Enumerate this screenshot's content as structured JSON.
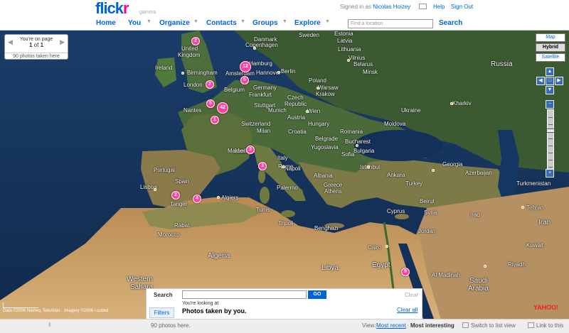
{
  "header": {
    "logo_main": "flick",
    "logo_r": "r",
    "logo_beta": "gamma",
    "signed_in_prefix": "Signed in as",
    "signed_in_user": "Nicolas Hoizey",
    "help": "Help",
    "sign_out": "Sign Out"
  },
  "nav": {
    "home": "Home",
    "you": "You",
    "organize": "Organize",
    "contacts": "Contacts",
    "groups": "Groups",
    "explore": "Explore",
    "location_placeholder": "Find a location",
    "search": "Search"
  },
  "pager": {
    "title": "You're on page",
    "page": "1",
    "of": "of",
    "total": "1",
    "subtitle": "90 photos taken here"
  },
  "map_types": {
    "map": "Map",
    "hybrid": "Hybrid",
    "satellite": "Satellite",
    "selected": "Hybrid"
  },
  "map_labels": [
    {
      "text": "Danmark",
      "big": false
    },
    {
      "text": "Copenhagen",
      "big": false
    },
    {
      "text": "Lithuania",
      "big": false
    },
    {
      "text": "Vilnius",
      "big": false
    },
    {
      "text": "Belarus",
      "big": false
    },
    {
      "text": "Russia",
      "big": true
    },
    {
      "text": "United",
      "big": false
    },
    {
      "text": "Kingdom",
      "big": false
    },
    {
      "text": "Ireland",
      "big": false
    },
    {
      "text": "Birmingham",
      "big": false
    },
    {
      "text": "London",
      "big": false
    },
    {
      "text": "Hamburg",
      "big": false
    },
    {
      "text": "Amsterdam",
      "big": false
    },
    {
      "text": "Hannover",
      "big": false
    },
    {
      "text": "Berlin",
      "big": false
    },
    {
      "text": "Belgium",
      "big": false
    },
    {
      "text": "Germany",
      "big": false
    },
    {
      "text": "Frankfurt",
      "big": false
    },
    {
      "text": "Poland",
      "big": false
    },
    {
      "text": "Warsaw",
      "big": false
    },
    {
      "text": "Krakow",
      "big": false
    },
    {
      "text": "Stuttgart",
      "big": false
    },
    {
      "text": "Czech",
      "big": false
    },
    {
      "text": "Republic",
      "big": false
    },
    {
      "text": "Munich",
      "big": false
    },
    {
      "text": "Wien",
      "big": false
    },
    {
      "text": "Austria",
      "big": false
    },
    {
      "text": "Switzerland",
      "big": false
    },
    {
      "text": "Milan",
      "big": false
    },
    {
      "text": "Ukraine",
      "big": false
    },
    {
      "text": "Kharkiv",
      "big": false
    },
    {
      "text": "Hungary",
      "big": false
    },
    {
      "text": "Moldova",
      "big": false
    },
    {
      "text": "Croatia",
      "big": false
    },
    {
      "text": "Belgrade",
      "big": false
    },
    {
      "text": "Romania",
      "big": false
    },
    {
      "text": "Bucharest",
      "big": false
    },
    {
      "text": "Yugoslavia",
      "big": false
    },
    {
      "text": "Bulgaria",
      "big": false
    },
    {
      "text": "Sofia",
      "big": false
    },
    {
      "text": "Monaco",
      "big": false
    },
    {
      "text": "Italy",
      "big": false
    },
    {
      "text": "Rome",
      "big": false
    },
    {
      "text": "Napoli",
      "big": false
    },
    {
      "text": "Albania",
      "big": false
    },
    {
      "text": "Greece",
      "big": false
    },
    {
      "text": "Athens",
      "big": false
    },
    {
      "text": "Istanbul",
      "big": false
    },
    {
      "text": "Ankara",
      "big": false
    },
    {
      "text": "Turkey",
      "big": false
    },
    {
      "text": "Georgia",
      "big": false
    },
    {
      "text": "Azerbaijan",
      "big": false
    },
    {
      "text": "Turkmenistan",
      "big": false
    },
    {
      "text": "Portugal",
      "big": false
    },
    {
      "text": "Lisboa",
      "big": false
    },
    {
      "text": "Spain",
      "big": false
    },
    {
      "text": "Tanger",
      "big": false
    },
    {
      "text": "Algiers",
      "big": false
    },
    {
      "text": "Tunis",
      "big": false
    },
    {
      "text": "Palermo",
      "big": false
    },
    {
      "text": "Cyprus",
      "big": false
    },
    {
      "text": "Beirut",
      "big": false
    },
    {
      "text": "Syria",
      "big": false
    },
    {
      "text": "Iraq",
      "big": false
    },
    {
      "text": "Tehran",
      "big": false
    },
    {
      "text": "Iran",
      "big": false
    },
    {
      "text": "Kuwait",
      "big": false
    },
    {
      "text": "Rabat",
      "big": false
    },
    {
      "text": "Morocco",
      "big": false
    },
    {
      "text": "Tripoli",
      "big": false
    },
    {
      "text": "Benghazi",
      "big": false
    },
    {
      "text": "Jordan",
      "big": false
    },
    {
      "text": "Cairo",
      "big": false
    },
    {
      "text": "Algeria",
      "big": true
    },
    {
      "text": "Libya",
      "big": true
    },
    {
      "text": "Egypt",
      "big": true
    },
    {
      "text": "Western",
      "big": true
    },
    {
      "text": "Sahara",
      "big": true
    },
    {
      "text": "Saudi",
      "big": true
    },
    {
      "text": "Arabia",
      "big": true
    },
    {
      "text": "Riyadh",
      "big": false
    },
    {
      "text": "Al Madinah",
      "big": false
    },
    {
      "text": "Sweden",
      "big": false
    },
    {
      "text": "Latvia",
      "big": false
    },
    {
      "text": "Estonia",
      "big": false
    },
    {
      "text": "Minsk",
      "big": false
    },
    {
      "text": "Marseille",
      "big": false
    },
    {
      "text": "Nantes",
      "big": false
    }
  ],
  "clusters": [
    {
      "count": "2"
    },
    {
      "count": "12"
    },
    {
      "count": "5"
    },
    {
      "count": "2"
    },
    {
      "count": "5"
    },
    {
      "count": "42"
    },
    {
      "count": "1"
    },
    {
      "count": "3"
    },
    {
      "count": "3"
    },
    {
      "count": "2"
    },
    {
      "count": "4"
    },
    {
      "count": "9"
    }
  ],
  "credits": {
    "data": "Data ©2006 Navteq, TeleAtlas",
    "imagery": "Imagery ©2006 i-cubed",
    "yahoo": "YAHOO!"
  },
  "search_panel": {
    "label": "Search",
    "go": "GO",
    "clear": "Clear",
    "looking_at": "You're looking at",
    "filter_desc": "Photos taken by you.",
    "clear_all": "Clear all",
    "filters_tab": "Filters"
  },
  "footer": {
    "count": "90 photos here.",
    "view_label": "View:",
    "most_recent": "Most recent",
    "separator": "·",
    "most_interesting": "Most interesting",
    "switch_list": "Switch to list view",
    "link": "Link to this"
  },
  "colors": {
    "brand_blue": "#0063dc",
    "brand_pink": "#ff0084",
    "cluster": "#ff3fa4"
  }
}
